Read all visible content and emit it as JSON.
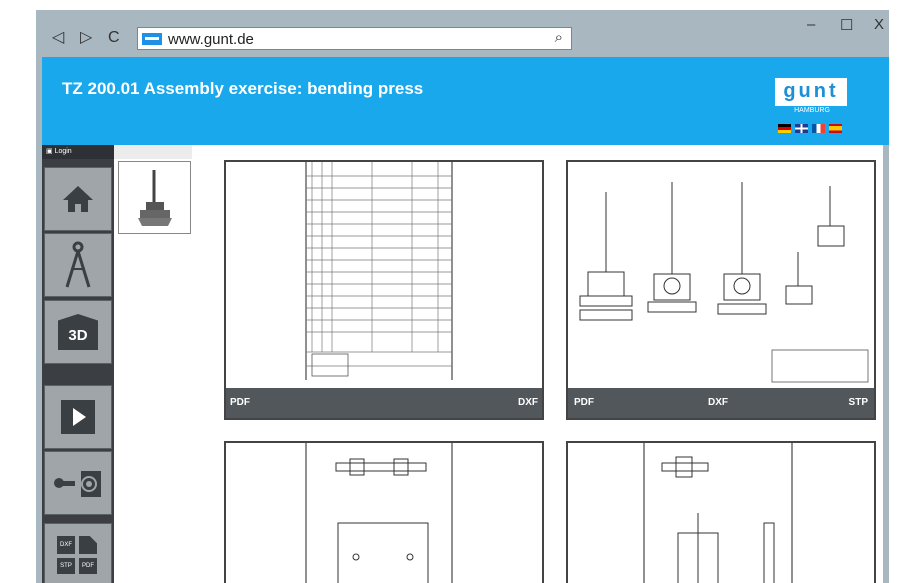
{
  "browser": {
    "back_icon": "◁",
    "forward_icon": "▷",
    "reload_icon": "C",
    "url": "www.gunt.de",
    "search_icon": "⌕",
    "minimize": "–",
    "maximize": "☐",
    "close": "X"
  },
  "app": {
    "title": "TZ 200.01 Assembly exercise: bending press",
    "logo": "gunt",
    "logo_sub": "HAMBURG",
    "login": "Login"
  },
  "sidebar": {
    "items": [
      {
        "icon": "home-icon"
      },
      {
        "icon": "compass-icon"
      },
      {
        "label": "3D"
      },
      {
        "icon": "play-icon"
      },
      {
        "icon": "bearing-icon"
      },
      {
        "icon": "file-formats-icon",
        "labels": [
          "DXF",
          "STP",
          "PDF"
        ]
      }
    ]
  },
  "cards": [
    {
      "buttons": [
        "PDF",
        "DXF"
      ]
    },
    {
      "buttons": [
        "PDF",
        "DXF",
        "STP"
      ]
    }
  ],
  "colors": {
    "accent": "#19a8ec",
    "sidebar": "#3b3f43",
    "frame": "#a9b7c1"
  }
}
